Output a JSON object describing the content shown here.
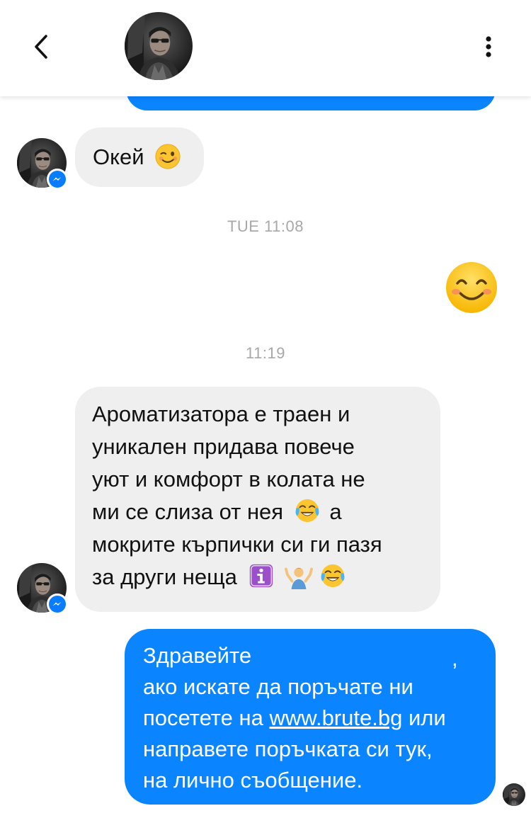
{
  "header": {
    "back_icon": "chevron-left-icon",
    "avatar_icon": "profile-avatar",
    "more_icon": "vertical-dots-icon"
  },
  "colors": {
    "outgoing_bubble": "#0a84ff",
    "incoming_bubble": "#efefef",
    "timestamp": "#a8a8a8"
  },
  "messages": {
    "okay": {
      "text": "Окей",
      "emoji": "winking-face-emoji"
    },
    "ts_tue": "TUE 11:08",
    "outgoing_emoji": "smiling-face-with-smiling-eyes-emoji",
    "ts_1119": "11:19",
    "long_incoming": {
      "line1": "Ароматизатора е траен и",
      "line2": "уникален придава повече",
      "line3": "уют и комфорт в колата не",
      "line4a": "ми се слиза от нея",
      "line4b": "а",
      "line5": "мокрите кърпички си ги пазя",
      "line6": "за други неща",
      "emojis": [
        "face-with-tears-of-joy-emoji",
        "information-emoji",
        "person-shrugging-emoji",
        "face-with-tears-of-joy-emoji"
      ]
    },
    "outgoing_reply": {
      "line1a": "Здравейте",
      "line1b": ",",
      "line2": "ако искате да поръчате ни",
      "line3a": "посетете на",
      "line3_link": "www.brute.bg",
      "line3b": "или",
      "line4": "направете поръчката си тук,",
      "line5": "на лично съобщение."
    }
  }
}
